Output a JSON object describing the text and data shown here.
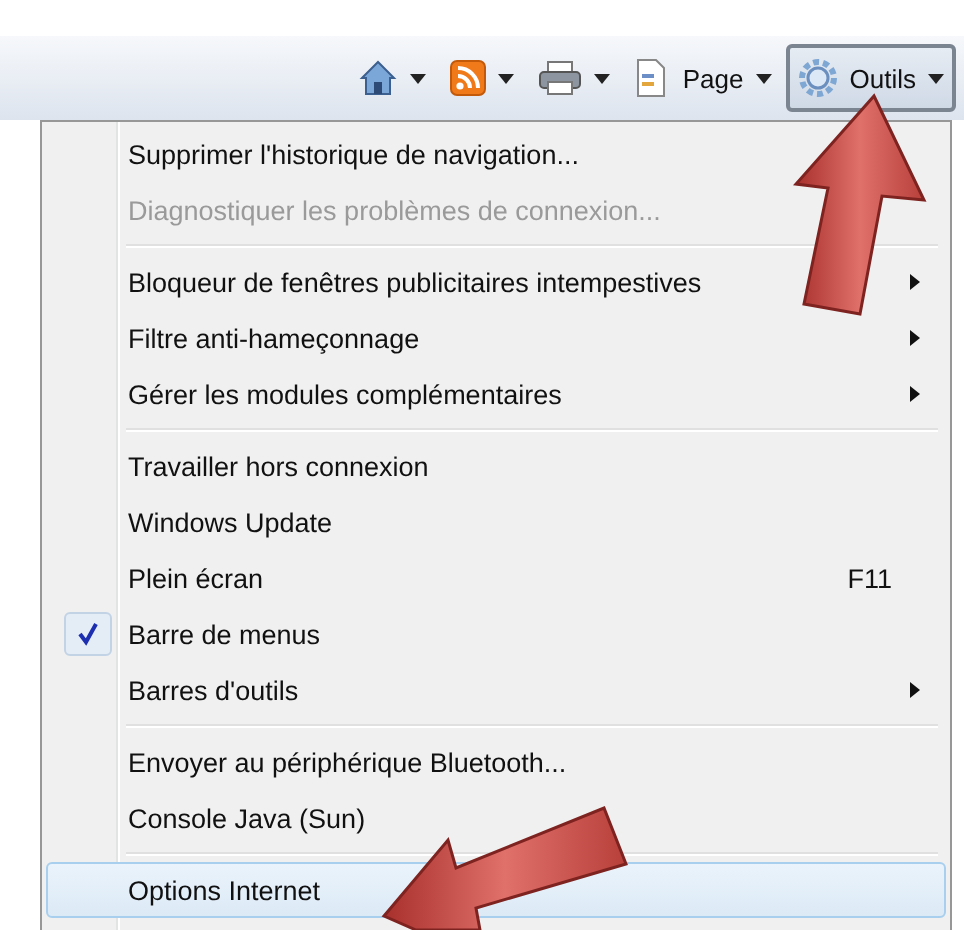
{
  "toolbar": [
    {
      "kind": "home",
      "pressed": false
    },
    {
      "kind": "feeds",
      "pressed": false
    },
    {
      "kind": "print",
      "pressed": false
    },
    {
      "kind": "page",
      "label": "Page",
      "pressed": false
    },
    {
      "kind": "tools",
      "label": "Outils",
      "pressed": true
    }
  ],
  "menu": [
    {
      "items": [
        {
          "label": "Supprimer l'historique de navigation...",
          "disabled": false,
          "checked": false,
          "submenu": false,
          "selected": false
        },
        {
          "label": "Diagnostiquer les problèmes de connexion...",
          "disabled": true,
          "checked": false,
          "submenu": false,
          "selected": false
        }
      ]
    },
    {
      "items": [
        {
          "label": "Bloqueur de fenêtres publicitaires intempestives",
          "disabled": false,
          "checked": false,
          "submenu": true,
          "selected": false
        },
        {
          "label": "Filtre anti-hameçonnage",
          "disabled": false,
          "checked": false,
          "submenu": true,
          "selected": false
        },
        {
          "label": "Gérer les modules complémentaires",
          "disabled": false,
          "checked": false,
          "submenu": true,
          "selected": false
        }
      ]
    },
    {
      "items": [
        {
          "label": "Travailler hors connexion",
          "disabled": false,
          "checked": false,
          "submenu": false,
          "selected": false
        },
        {
          "label": "Windows Update",
          "disabled": false,
          "checked": false,
          "submenu": false,
          "selected": false
        },
        {
          "label": "Plein écran",
          "shortcut": "F11",
          "disabled": false,
          "checked": false,
          "submenu": false,
          "selected": false
        },
        {
          "label": "Barre de menus",
          "disabled": false,
          "checked": true,
          "submenu": false,
          "selected": false
        },
        {
          "label": "Barres d'outils",
          "disabled": false,
          "checked": false,
          "submenu": true,
          "selected": false
        }
      ]
    },
    {
      "items": [
        {
          "label": "Envoyer au périphérique Bluetooth...",
          "disabled": false,
          "checked": false,
          "submenu": false,
          "selected": false
        },
        {
          "label": "Console Java (Sun)",
          "disabled": false,
          "checked": false,
          "submenu": false,
          "selected": false
        }
      ]
    },
    {
      "items": [
        {
          "label": "Options Internet",
          "disabled": false,
          "checked": false,
          "submenu": false,
          "selected": true
        }
      ]
    }
  ]
}
